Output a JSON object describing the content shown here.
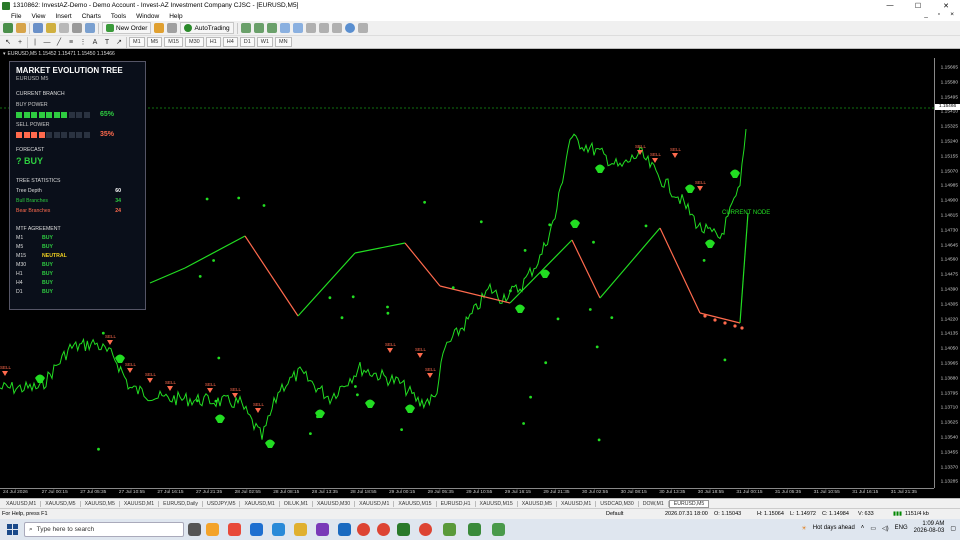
{
  "window": {
    "title": "1310862: InvestAZ-Demo - Demo Account - Invest-AZ Investment Company CJSC - [EURUSD,M5]",
    "minimize": "—",
    "maximize": "☐",
    "close": "✕"
  },
  "menu": {
    "items": [
      "File",
      "View",
      "Insert",
      "Charts",
      "Tools",
      "Window",
      "Help"
    ],
    "win_min": "_",
    "win_max": "▫",
    "win_close": "×"
  },
  "toolbar": {
    "new_order": "New Order",
    "auto_trading": "AutoTrading",
    "timeframes": [
      "M1",
      "M5",
      "M15",
      "M30",
      "H1",
      "H4",
      "D1",
      "W1",
      "MN"
    ]
  },
  "chart": {
    "symbol_line": "EURUSD,M5  1.15452 1.15471 1.15450 1.15466",
    "current_price": "1.15466",
    "current_node_label": "CURRENT NODE",
    "price_labels": [
      "1.15665",
      "1.15580",
      "1.15495",
      "1.15410",
      "1.15325",
      "1.15240",
      "1.15155",
      "1.15070",
      "1.14985",
      "1.14900",
      "1.14815",
      "1.14730",
      "1.14645",
      "1.14560",
      "1.14475",
      "1.14390",
      "1.14305",
      "1.14220",
      "1.14135",
      "1.14050",
      "1.13965",
      "1.13880",
      "1.13795",
      "1.13710",
      "1.13625",
      "1.13540",
      "1.13455",
      "1.13370",
      "1.13285"
    ],
    "time_labels": [
      "24 Jul 2026",
      "27 Jul 00:15",
      "27 Jul 05:35",
      "27 Jul 10:55",
      "27 Jul 16:15",
      "27 Jul 21:35",
      "28 Jul 02:55",
      "28 Jul 08:15",
      "28 Jul 13:35",
      "28 Jul 18:55",
      "29 Jul 00:15",
      "29 Jul 05:35",
      "29 Jul 10:55",
      "29 Jul 16:15",
      "29 Jul 21:35",
      "30 Jul 02:55",
      "30 Jul 08:15",
      "30 Jul 13:35",
      "30 Jul 18:55",
      "31 Jul 00:15",
      "31 Jul 05:35",
      "31 Jul 10:55",
      "31 Jul 16:15",
      "31 Jul 21:35"
    ],
    "signal_label": "SELL",
    "colors": {
      "bull": "#22dd22",
      "bear": "#ff6a4d",
      "background": "#000000"
    }
  },
  "panel": {
    "title": "MARKET EVOLUTION TREE",
    "symbol": "EURUSD  M5",
    "current_branch_label": "CURRENT BRANCH",
    "buy_power_label": "BUY POWER",
    "buy_power_pct": "65%",
    "buy_power_value": 0.65,
    "sell_power_label": "SELL POWER",
    "sell_power_pct": "35%",
    "sell_power_value": 0.35,
    "forecast_label": "FORECAST",
    "forecast_value": "? BUY",
    "stats_label": "TREE STATISTICS",
    "tree_depth_label": "Tree Depth",
    "tree_depth": "60",
    "bull_branches_label": "Bull Branches",
    "bull_branches": "34",
    "bear_branches_label": "Bear Branches",
    "bear_branches": "24",
    "mtf_label": "MTF AGREEMENT",
    "mtf": [
      {
        "tf": "M1",
        "signal": "BUY"
      },
      {
        "tf": "M5",
        "signal": "BUY"
      },
      {
        "tf": "M15",
        "signal": "NEUTRAL"
      },
      {
        "tf": "M30",
        "signal": "BUY"
      },
      {
        "tf": "H1",
        "signal": "BUY"
      },
      {
        "tf": "H4",
        "signal": "BUY"
      },
      {
        "tf": "D1",
        "signal": "BUY"
      }
    ]
  },
  "symbol_tabs": [
    "XAUUSD,M1",
    "XAUUSD,M5",
    "XAUUSD,M5",
    "XAUUSD,M1",
    "EURUSD,Daily",
    "USDJPY,M5",
    "XAUUSD,M1",
    "OILUK,M1",
    "XAUUSD,M30",
    "XAUUSD,M1",
    "XAUUSD,M15",
    "EURUSD,H1",
    "XAUUSD,M15",
    "XAUUSD,M5",
    "XAUUSD,M1",
    "USDCAD,M30",
    "DOW,M1",
    "EURUSD,M5"
  ],
  "status": {
    "help": "For Help, press F1",
    "profile": "Default",
    "datetime": "2026.07.31 18:00",
    "open": "O: 1.15043",
    "high": "H: 1.15064",
    "low": "L: 1.14972",
    "close": "C: 1.14984",
    "volume": "V: 633",
    "traffic": "1151/4 kb"
  },
  "taskbar": {
    "search_placeholder": "Type here to search",
    "weather": "Hot days ahead",
    "lang": "ENG",
    "time": "1:09 AM",
    "date": "2026-08-03"
  }
}
